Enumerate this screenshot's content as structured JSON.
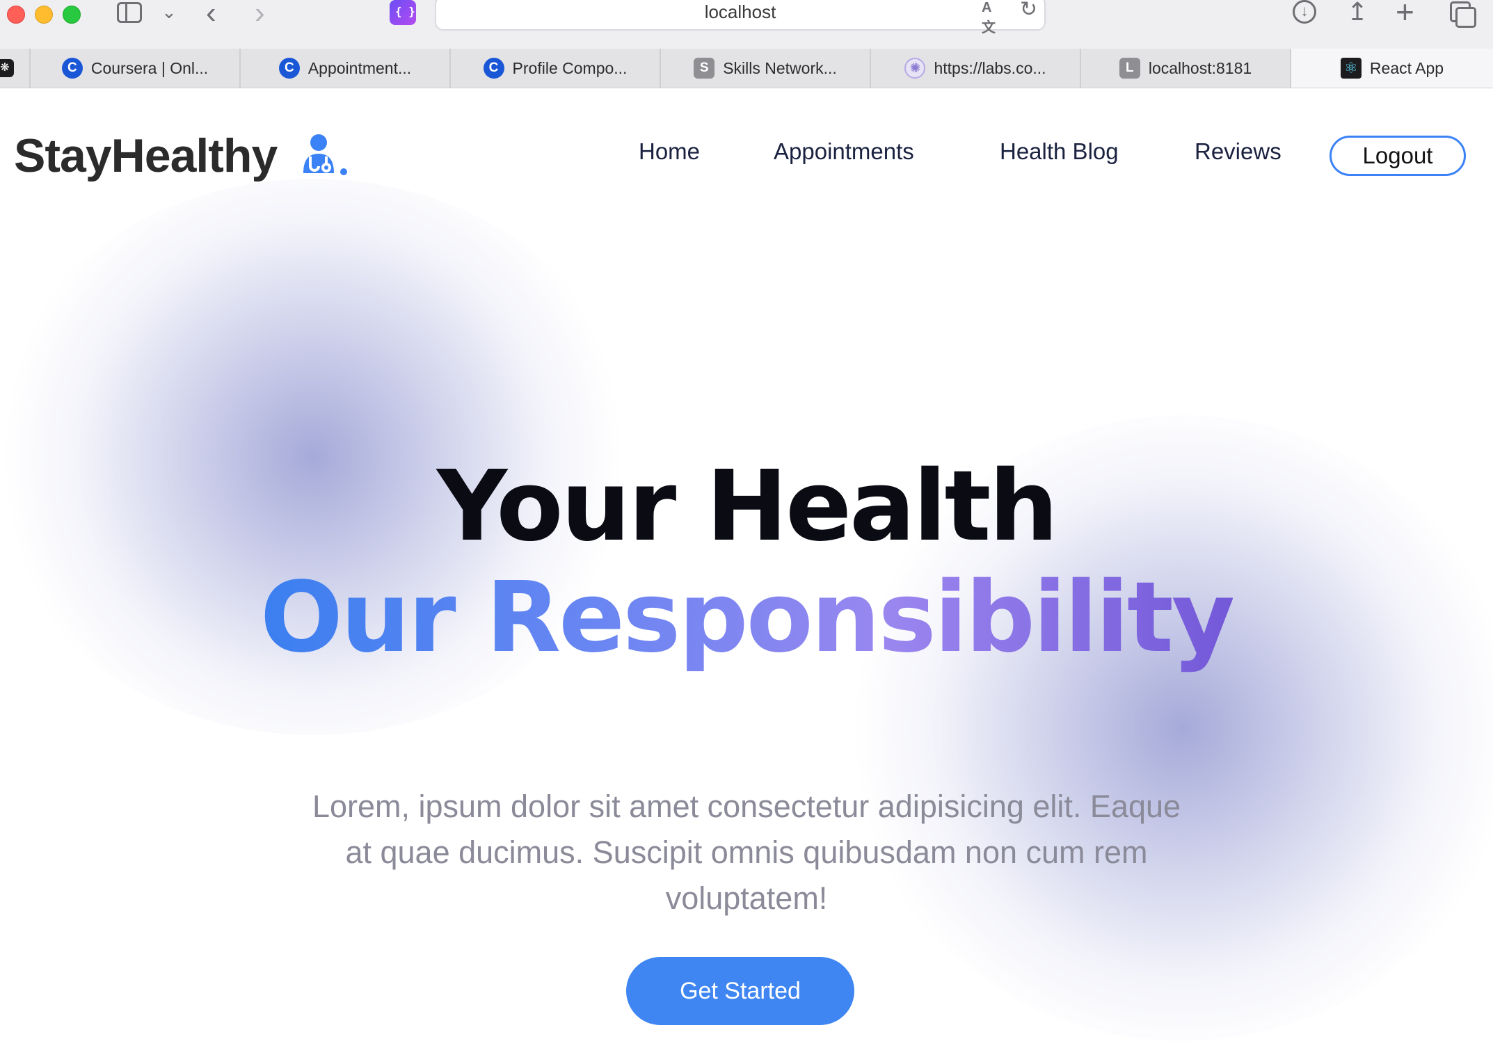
{
  "browser": {
    "url": "localhost",
    "tabs": [
      {
        "favicon": "coursera-c-icon",
        "title": "Coursera | Onl..."
      },
      {
        "favicon": "coursera-c-icon",
        "title": "Appointment..."
      },
      {
        "favicon": "coursera-c-icon",
        "title": "Profile Compo..."
      },
      {
        "favicon": "s-letter-icon",
        "title": "Skills Network..."
      },
      {
        "favicon": "web-globe-icon",
        "title": "https://labs.co..."
      },
      {
        "favicon": "l-letter-icon",
        "title": "localhost:8181"
      },
      {
        "favicon": "react-icon",
        "title": "React App"
      }
    ],
    "favicon_letters": {
      "c": "C",
      "s": "S",
      "l": "L"
    }
  },
  "navbar": {
    "logo_text": "StayHealthy",
    "links": [
      "Home",
      "Appointments",
      "Health Blog",
      "Reviews"
    ],
    "logout_label": "Logout",
    "accent_color": "#3b82f6"
  },
  "hero": {
    "title_line1": "Your Health",
    "title_line2": "Our Responsibility",
    "description": "Lorem, ipsum dolor sit amet consectetur adipisicing elit. Eaque at quae ducimus. Suscipit omnis quibusdam non cum rem voluptatem!",
    "cta_label": "Get Started",
    "cta_color": "#3f86f2",
    "gradient_colors": [
      "#3b7ff0",
      "#6a86f2",
      "#9a86ef",
      "#7358d8"
    ]
  }
}
